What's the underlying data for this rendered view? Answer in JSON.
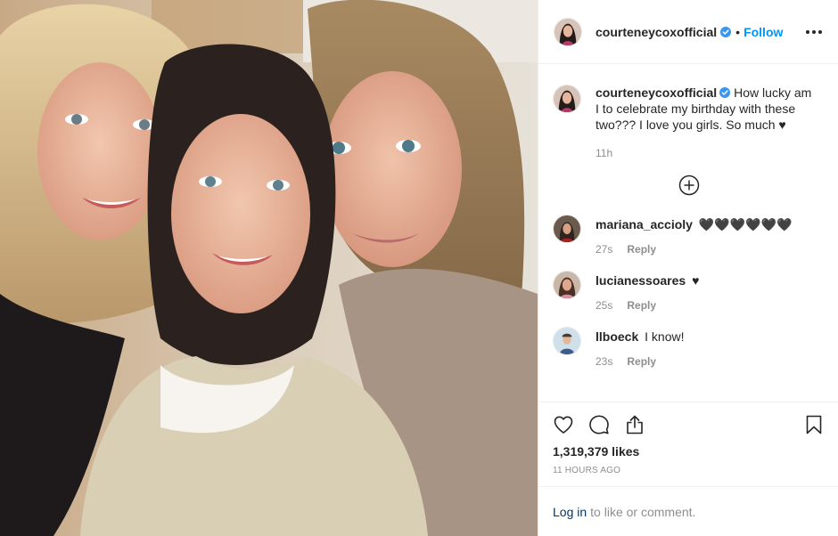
{
  "header": {
    "username": "courteneycoxofficial",
    "separator": "•",
    "follow_label": "Follow"
  },
  "caption": {
    "username": "courteneycoxofficial",
    "text": "How lucky am I to celebrate my birthday with these two??? I love you girls. So much ♥",
    "time": "11h"
  },
  "comments": [
    {
      "username": "mariana_accioly",
      "text": "🖤🖤🖤🖤🖤🖤",
      "time": "27s",
      "reply_label": "Reply"
    },
    {
      "username": "lucianessoares",
      "text": "♥",
      "time": "25s",
      "reply_label": "Reply"
    },
    {
      "username": "llboeck",
      "text": "I know!",
      "time": "23s",
      "reply_label": "Reply"
    }
  ],
  "engagement": {
    "likes": "1,319,379 likes",
    "timestamp": "11 HOURS AGO"
  },
  "footer": {
    "login_label": "Log in",
    "suffix": "to like or comment."
  },
  "icons": {
    "verified": "verified-badge-icon",
    "more": "more-options-icon",
    "load_more": "plus-circle-icon",
    "like": "heart-icon",
    "comment": "comment-bubble-icon",
    "share": "share-icon",
    "save": "bookmark-icon"
  },
  "colors": {
    "link_blue": "#0095f6",
    "login_blue": "#00376b",
    "secondary_text": "#8e8e8e",
    "primary_text": "#262626",
    "verified_blue": "#3897f0"
  }
}
